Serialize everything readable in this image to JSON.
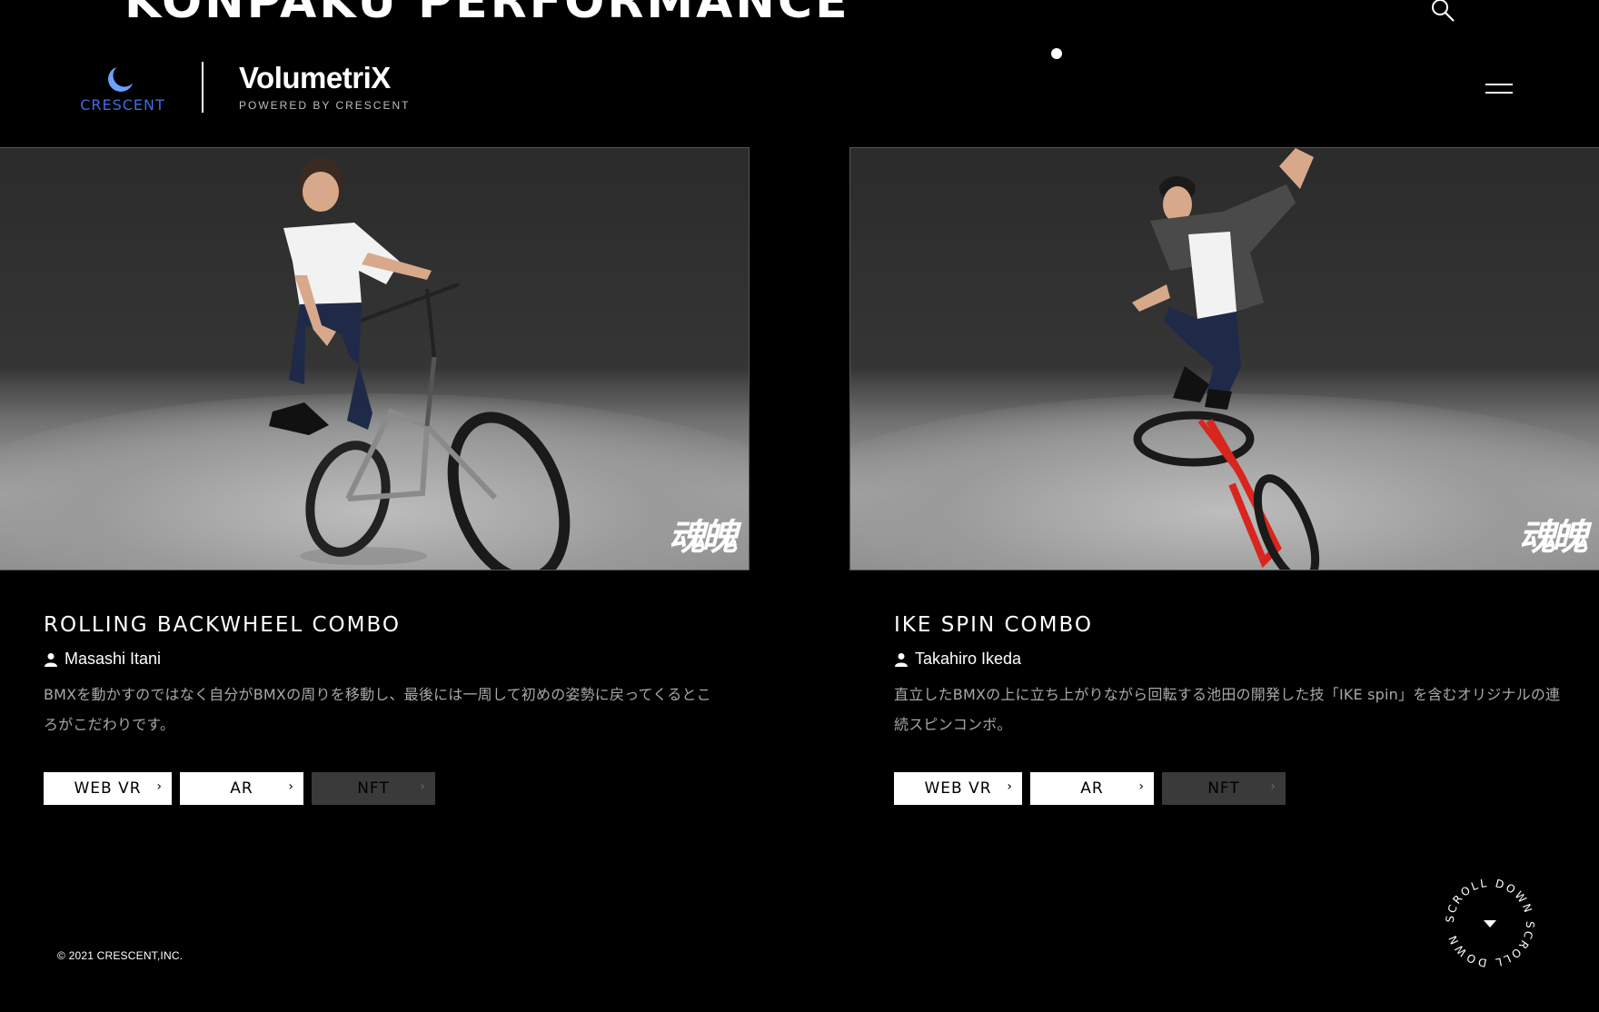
{
  "header": {
    "hero_title": "KONPAKU PERFORMANCE",
    "crescent_logo_text": "CRESCENT",
    "volumetrix_name": "VolumetriX",
    "volumetrix_tagline": "POWERED BY CRESCENT"
  },
  "colors": {
    "background": "#000000",
    "crescent_blue": "#3c6fe0",
    "button_bg": "#ffffff",
    "button_disabled_bg": "#3a3a3a"
  },
  "cards": [
    {
      "title": "ROLLING BACKWHEEL COMBO",
      "author": "Masashi Itani",
      "description": "BMXを動かすのではなく自分がBMXの周りを移動し、最後には一周して初めの姿勢に戻ってくるところがこだわりです。",
      "watermark": "魂魄",
      "buttons": {
        "webvr": "WEB VR",
        "ar": "AR",
        "nft": "NFT"
      }
    },
    {
      "title": "IKE SPIN COMBO",
      "author": "Takahiro Ikeda",
      "description": "直立したBMXの上に立ち上がりながら回転する池田の開発した技「IKE spin」を含むオリジナルの連続スピンコンボ。",
      "watermark": "魂魄",
      "buttons": {
        "webvr": "WEB VR",
        "ar": "AR",
        "nft": "NFT"
      }
    }
  ],
  "footer": {
    "copyright": "© 2021 CRESCENT,INC.",
    "scroll_label": "SCROLL DOWN SCROLL DOWN"
  },
  "icons": {
    "search": "search-icon",
    "menu": "hamburger-menu-icon",
    "person": "person-icon",
    "chevron": "chevron-right-icon",
    "scroll": "triangle-down-icon"
  }
}
